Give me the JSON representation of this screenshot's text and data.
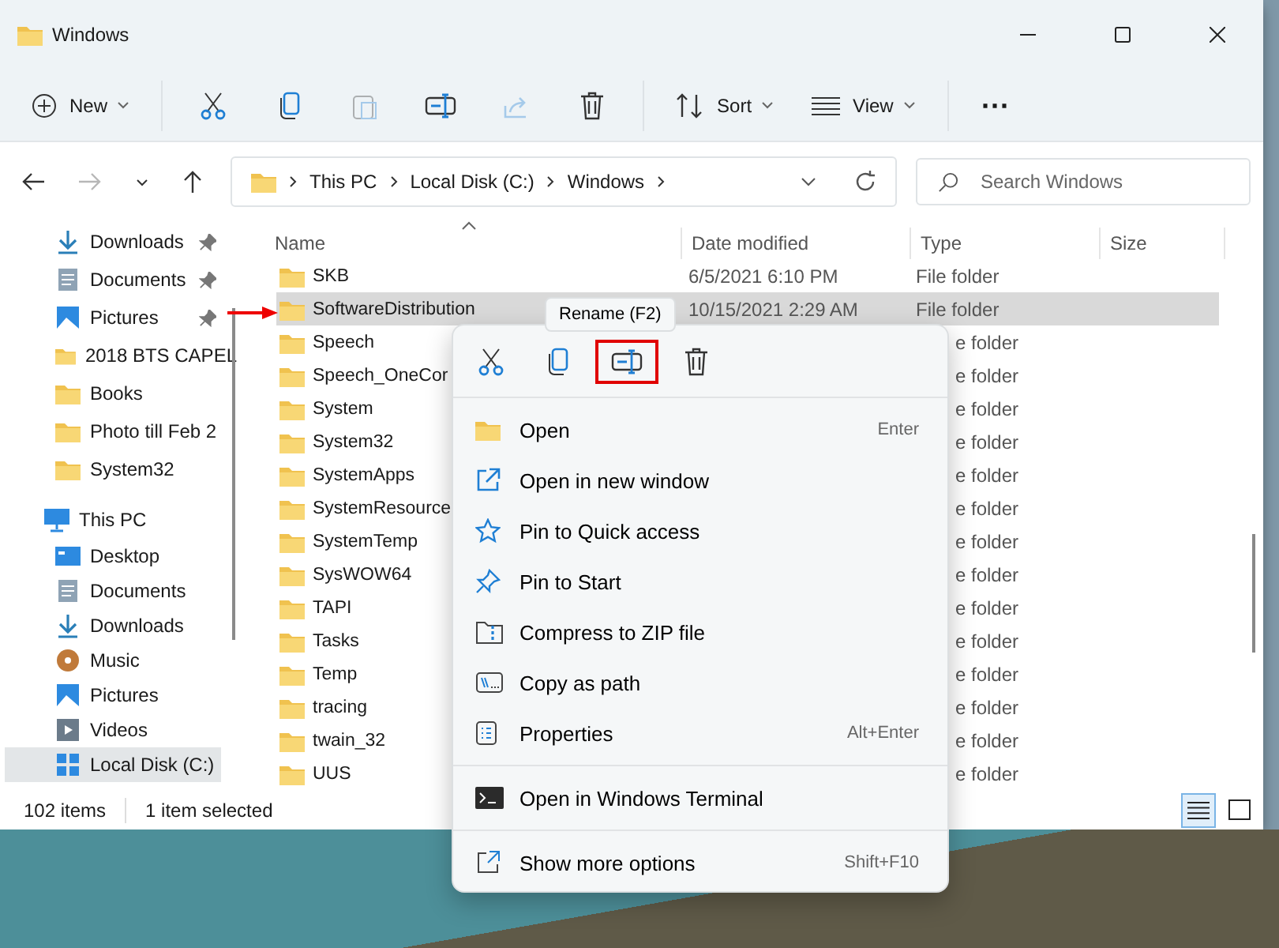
{
  "window": {
    "title": "Windows"
  },
  "toolbar": {
    "new_label": "New",
    "sort_label": "Sort",
    "view_label": "View",
    "more": "⋯",
    "actions": [
      {
        "disabled": false
      },
      {
        "disabled": false
      },
      {
        "disabled": true
      },
      {
        "disabled": false
      },
      {
        "disabled": true
      },
      {
        "disabled": false
      }
    ]
  },
  "address": {
    "forward_disabled": true,
    "breadcrumbs": [
      "This PC",
      "Local Disk (C:)",
      "Windows"
    ]
  },
  "search": {
    "placeholder": "Search Windows"
  },
  "sidebar": {
    "items": [
      {
        "label": "Downloads",
        "pinned": true,
        "selected": false
      },
      {
        "label": "Documents",
        "pinned": true,
        "selected": false
      },
      {
        "label": "Pictures",
        "pinned": true,
        "selected": false
      },
      {
        "label": "2018 BTS CAPEL",
        "pinned": false,
        "selected": false
      },
      {
        "label": "Books",
        "pinned": false,
        "selected": false
      },
      {
        "label": "Photo  till Feb 2",
        "pinned": false,
        "selected": false
      },
      {
        "label": "System32",
        "pinned": false,
        "selected": false
      },
      {
        "label": "This PC",
        "selected": false,
        "children": [
          {
            "label": "Desktop",
            "pinned": false,
            "selected": false
          },
          {
            "label": "Documents",
            "pinned": false,
            "selected": false
          },
          {
            "label": "Downloads",
            "pinned": false,
            "selected": false
          },
          {
            "label": "Music",
            "pinned": false,
            "selected": false
          },
          {
            "label": "Pictures",
            "pinned": false,
            "selected": false
          },
          {
            "label": "Videos",
            "pinned": false,
            "selected": false
          },
          {
            "label": "Local Disk (C:)",
            "pinned": false,
            "selected": true
          }
        ]
      }
    ]
  },
  "table": {
    "columns": [
      "Name",
      "Date modified",
      "Type",
      "Size"
    ],
    "rows": [
      {
        "name": "SKB",
        "date": "6/5/2021 6:10 PM",
        "type": "File folder",
        "selected": false,
        "kind": "full"
      },
      {
        "name": "SoftwareDistribution",
        "date": "10/15/2021 2:29 AM",
        "type": "File folder",
        "selected": true,
        "kind": "full"
      },
      {
        "name": "Speech",
        "type": "e folder",
        "selected": false,
        "kind": "covered"
      },
      {
        "name": "Speech_OneCor",
        "type": "e folder",
        "selected": false,
        "kind": "covered"
      },
      {
        "name": "System",
        "type": "e folder",
        "selected": false,
        "kind": "covered"
      },
      {
        "name": "System32",
        "type": "e folder",
        "selected": false,
        "kind": "covered"
      },
      {
        "name": "SystemApps",
        "type": "e folder",
        "selected": false,
        "kind": "covered"
      },
      {
        "name": "SystemResource",
        "type": "e folder",
        "selected": false,
        "kind": "covered"
      },
      {
        "name": "SystemTemp",
        "type": "e folder",
        "selected": false,
        "kind": "covered"
      },
      {
        "name": "SysWOW64",
        "type": "e folder",
        "selected": false,
        "kind": "covered"
      },
      {
        "name": "TAPI",
        "type": "e folder",
        "selected": false,
        "kind": "covered"
      },
      {
        "name": "Tasks",
        "type": "e folder",
        "selected": false,
        "kind": "covered"
      },
      {
        "name": "Temp",
        "type": "e folder",
        "selected": false,
        "kind": "covered"
      },
      {
        "name": "tracing",
        "type": "e folder",
        "selected": false,
        "kind": "covered"
      },
      {
        "name": "twain_32",
        "type": "e folder",
        "selected": false,
        "kind": "covered"
      },
      {
        "name": "UUS",
        "type": "e folder",
        "selected": false,
        "kind": "covered"
      }
    ]
  },
  "status_bar": {
    "count": "102 items",
    "selection": "1 item selected",
    "view_buttons": [
      {
        "selected": true
      },
      {
        "selected": false
      }
    ]
  },
  "context_menu": {
    "tooltip": "Rename (F2)",
    "quick_actions": [
      {
        "highlighted": false
      },
      {
        "highlighted": false
      },
      {
        "highlighted": true
      },
      {
        "highlighted": false
      }
    ],
    "sections": [
      [
        {
          "label": "Open",
          "shortcut": "Enter"
        },
        {
          "label": "Open in new window"
        },
        {
          "label": "Pin to Quick access"
        },
        {
          "label": "Pin to Start"
        },
        {
          "label": "Compress to ZIP file"
        },
        {
          "label": "Copy as path"
        },
        {
          "label": "Properties",
          "shortcut": "Alt+Enter"
        }
      ],
      [
        {
          "label": "Open in Windows Terminal"
        }
      ],
      [
        {
          "label": "Show more options",
          "shortcut": "Shift+F10"
        }
      ]
    ]
  }
}
